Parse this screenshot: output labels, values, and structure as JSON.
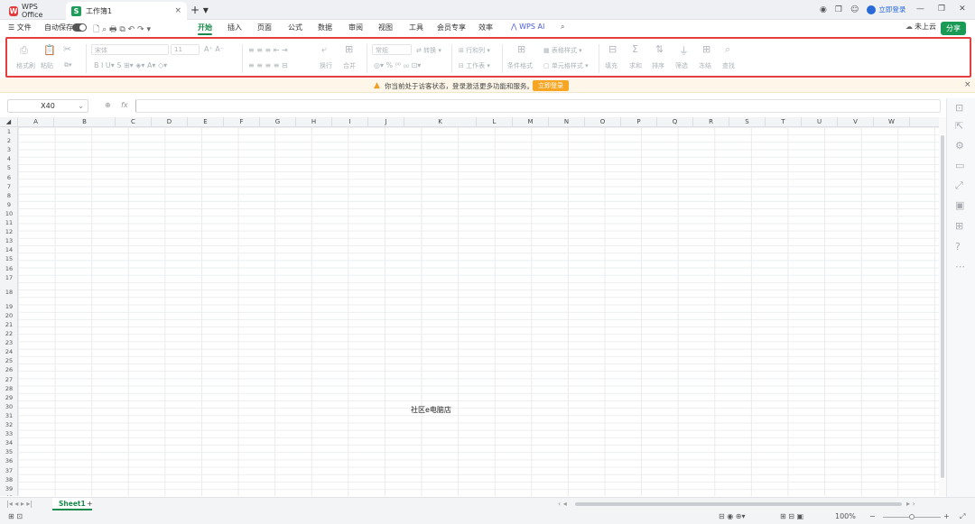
{
  "titlebar": {
    "app_tab": "WPS Office",
    "app_logo": "W",
    "doc_tab": "工作簿1",
    "doc_logo": "S",
    "close": "×",
    "new_tab": "+ ▾",
    "login": "立即登录"
  },
  "menu": {
    "file": "☰ 文件",
    "autosave": "自动保存",
    "items": [
      "开始",
      "插入",
      "页面",
      "公式",
      "数据",
      "审阅",
      "视图",
      "工具",
      "会员专享",
      "效率"
    ],
    "wps_ai": "WPS AI",
    "cloud": "未上云",
    "share": "分享"
  },
  "ribbon": {
    "format_painter": "格式刷",
    "paste": "粘贴",
    "font": "宋体",
    "font_size": "11",
    "wrap": "换行",
    "merge": "合并",
    "number_format": "常规",
    "convert": "转换",
    "row_col": "行和列",
    "worksheet": "工作表",
    "cond_format": "条件格式",
    "table_style": "表格样式",
    "cell_style": "单元格样式",
    "fill": "填充",
    "sum": "求和",
    "sort": "排序",
    "filter": "筛选",
    "freeze": "冻结",
    "find": "查找"
  },
  "notice": {
    "message": "你当前处于访客状态，登录激活更多功能和服务。",
    "button": "立即登录",
    "close": "×"
  },
  "formula_bar": {
    "name_box": "X40",
    "value": ""
  },
  "grid": {
    "columns": [
      "A",
      "B",
      "C",
      "D",
      "E",
      "F",
      "G",
      "H",
      "I",
      "J",
      "K",
      "L",
      "M",
      "N",
      "O",
      "P",
      "Q",
      "R",
      "S",
      "T",
      "U",
      "V",
      "W"
    ],
    "rows": [
      "1",
      "2",
      "3",
      "4",
      "5",
      "6",
      "7",
      "8",
      "9",
      "10",
      "11",
      "12",
      "13",
      "14",
      "15",
      "16",
      "17",
      "18",
      "19",
      "20",
      "21",
      "22",
      "23",
      "24",
      "25",
      "26",
      "27",
      "28",
      "29",
      "30",
      "31",
      "32",
      "33",
      "34",
      "35",
      "36",
      "37",
      "38",
      "39",
      "40"
    ],
    "cell_K18": "社区e电脑店"
  },
  "sheets": {
    "active": "Sheet1",
    "add": "+"
  },
  "status": {
    "zoom": "100%"
  },
  "colors": {
    "accent": "#1a8a4c",
    "highlight_border": "#e53e3e",
    "notice_button": "#f6a623"
  }
}
